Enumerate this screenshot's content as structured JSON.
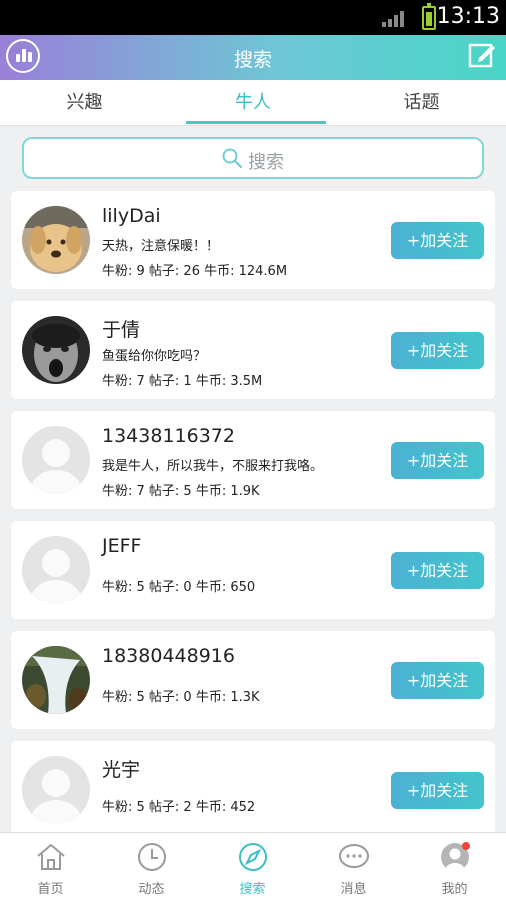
{
  "status_bar": {
    "time": "13:13"
  },
  "header": {
    "title": "搜索"
  },
  "tabs": [
    {
      "label": "兴趣"
    },
    {
      "label": "牛人"
    },
    {
      "label": "话题"
    }
  ],
  "search": {
    "placeholder": "搜索"
  },
  "follow_label": "+加关注",
  "users": [
    {
      "name": "lilyDai",
      "bio": "天热，注意保暖！！",
      "stats": "牛粉: 9 帖子: 26 牛币: 124.6M",
      "avatar": "dog-photo"
    },
    {
      "name": "于倩",
      "bio": "鱼蛋给你你吃吗？",
      "stats": "牛粉: 7 帖子: 1 牛币: 3.5M",
      "avatar": "screaming-face-photo"
    },
    {
      "name": "13438116372",
      "bio": "我是牛人，所以我牛，不服来打我咯。",
      "stats": "牛粉: 7 帖子: 5 牛币: 1.9K",
      "avatar": "default-avatar"
    },
    {
      "name": "JEFF",
      "bio": "",
      "stats": "牛粉: 5 帖子: 0 牛币: 650",
      "avatar": "default-avatar"
    },
    {
      "name": "18380448916",
      "bio": "",
      "stats": "牛粉: 5 帖子: 0 牛币: 1.3K",
      "avatar": "waterfall-photo"
    },
    {
      "name": "光宇",
      "bio": "",
      "stats": "牛粉: 5 帖子: 2 牛币: 452",
      "avatar": "default-avatar"
    }
  ],
  "bottom_nav": [
    {
      "label": "首页",
      "icon": "home-icon"
    },
    {
      "label": "动态",
      "icon": "clock-icon"
    },
    {
      "label": "搜索",
      "icon": "compass-icon"
    },
    {
      "label": "消息",
      "icon": "chat-icon"
    },
    {
      "label": "我的",
      "icon": "profile-icon"
    }
  ],
  "colors": {
    "accent": "#3bbec4",
    "follow_button": "#47bccf",
    "header_start": "#9a7fd8",
    "header_end": "#48d6c6"
  }
}
